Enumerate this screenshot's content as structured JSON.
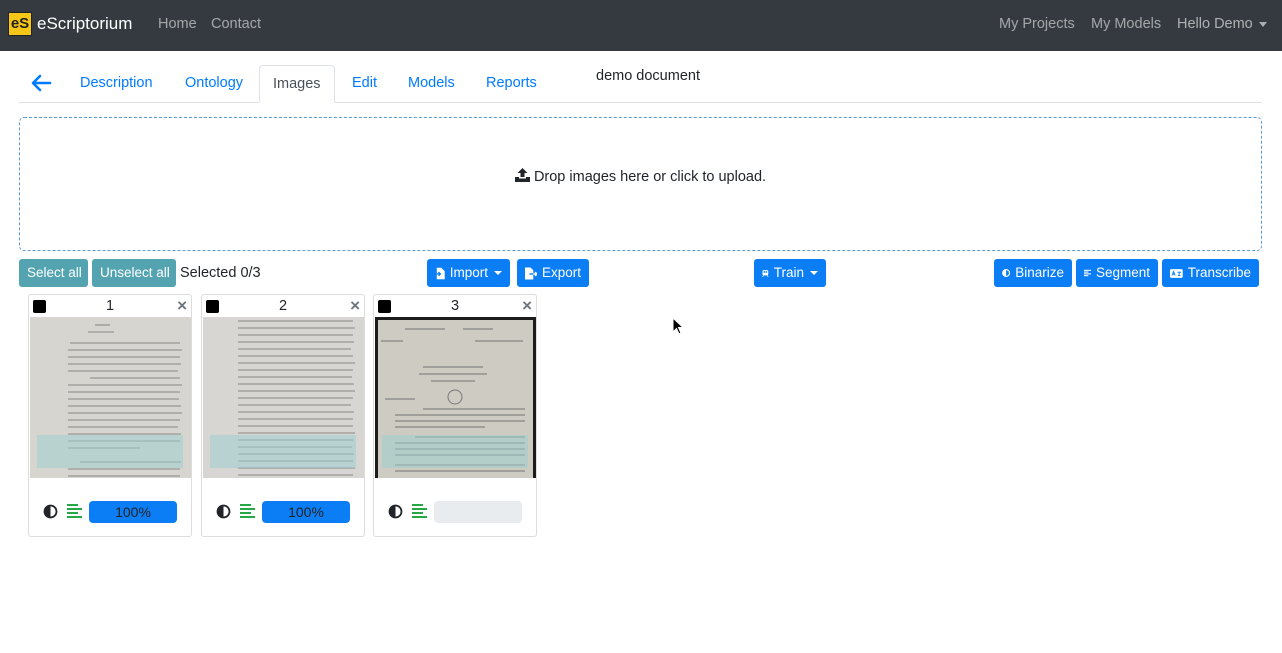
{
  "navbar": {
    "brand": "eScriptorium",
    "logo_text": "eS",
    "links": [
      "Home",
      "Contact"
    ],
    "right_links": [
      "My Projects",
      "My Models"
    ],
    "user": "Hello Demo"
  },
  "tabs": {
    "items": [
      "Description",
      "Ontology",
      "Images",
      "Edit",
      "Models",
      "Reports"
    ],
    "active": "Images"
  },
  "document_title": "demo document",
  "dropzone": {
    "message": "Drop images here or click to upload."
  },
  "toolbar": {
    "select_all": "Select all",
    "unselect_all": "Unselect all",
    "selected": "Selected 0/3",
    "import": "Import",
    "export": "Export",
    "train": "Train",
    "binarize": "Binarize",
    "segment": "Segment",
    "transcribe": "Transcribe"
  },
  "cards": [
    {
      "number": "1",
      "progress_label": "100%",
      "progress": 1.0,
      "close": "×"
    },
    {
      "number": "2",
      "progress_label": "100%",
      "progress": 1.0,
      "close": "×"
    },
    {
      "number": "3",
      "progress_label": "",
      "progress": 0.0,
      "close": "×"
    }
  ],
  "colors": {
    "navbar_bg": "#343a40",
    "link_blue": "#007bff",
    "btn_primary": "#0b7ef5",
    "btn_info": "#53a4b0",
    "segment_green": "#28a745"
  }
}
